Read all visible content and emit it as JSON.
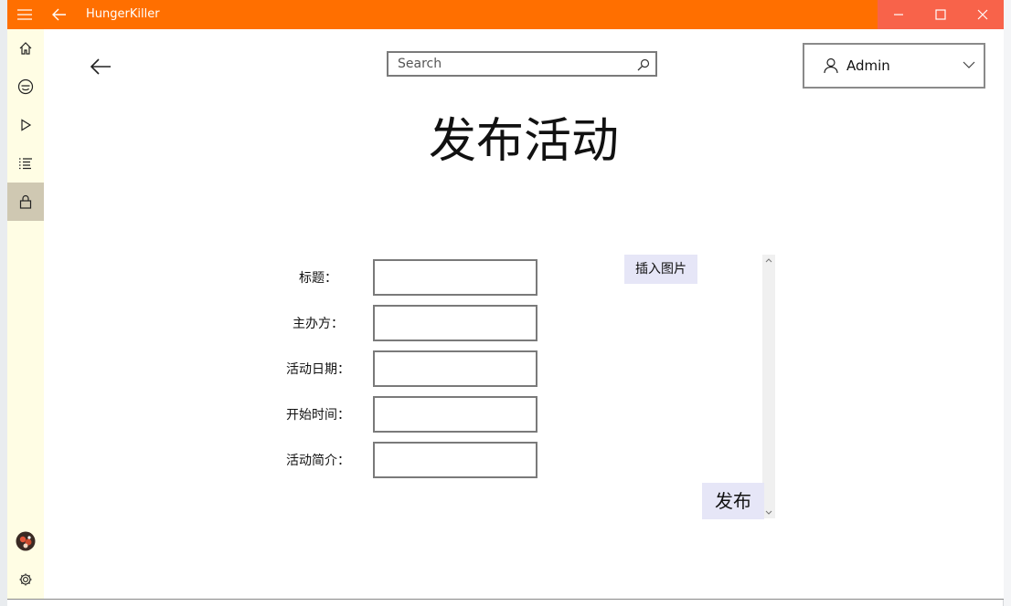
{
  "window": {
    "title": "HungerKiller"
  },
  "search": {
    "placeholder": "Search"
  },
  "user": {
    "name": "Admin"
  },
  "page": {
    "title": "发布活动"
  },
  "form": {
    "fields": [
      {
        "label": "标题：",
        "value": ""
      },
      {
        "label": "主办方：",
        "value": ""
      },
      {
        "label": "活动日期：",
        "value": ""
      },
      {
        "label": "开始时间：",
        "value": ""
      },
      {
        "label": "活动简介：",
        "value": ""
      }
    ],
    "insert_image_label": "插入图片",
    "publish_label": "发布"
  },
  "sidebar": {
    "items": [
      {
        "icon": "home-icon"
      },
      {
        "icon": "smiley-icon"
      },
      {
        "icon": "play-icon"
      },
      {
        "icon": "list-icon"
      },
      {
        "icon": "lock-icon",
        "selected": true
      }
    ],
    "bottom": [
      {
        "icon": "avatar"
      },
      {
        "icon": "gear-icon"
      }
    ]
  },
  "colors": {
    "titlebar": "#ff6f00",
    "caption_controls": "#f8634a",
    "sidebar": "#fffde4",
    "sidebar_selected": "#cfc8b2",
    "button_bg": "#e6e6f7"
  }
}
